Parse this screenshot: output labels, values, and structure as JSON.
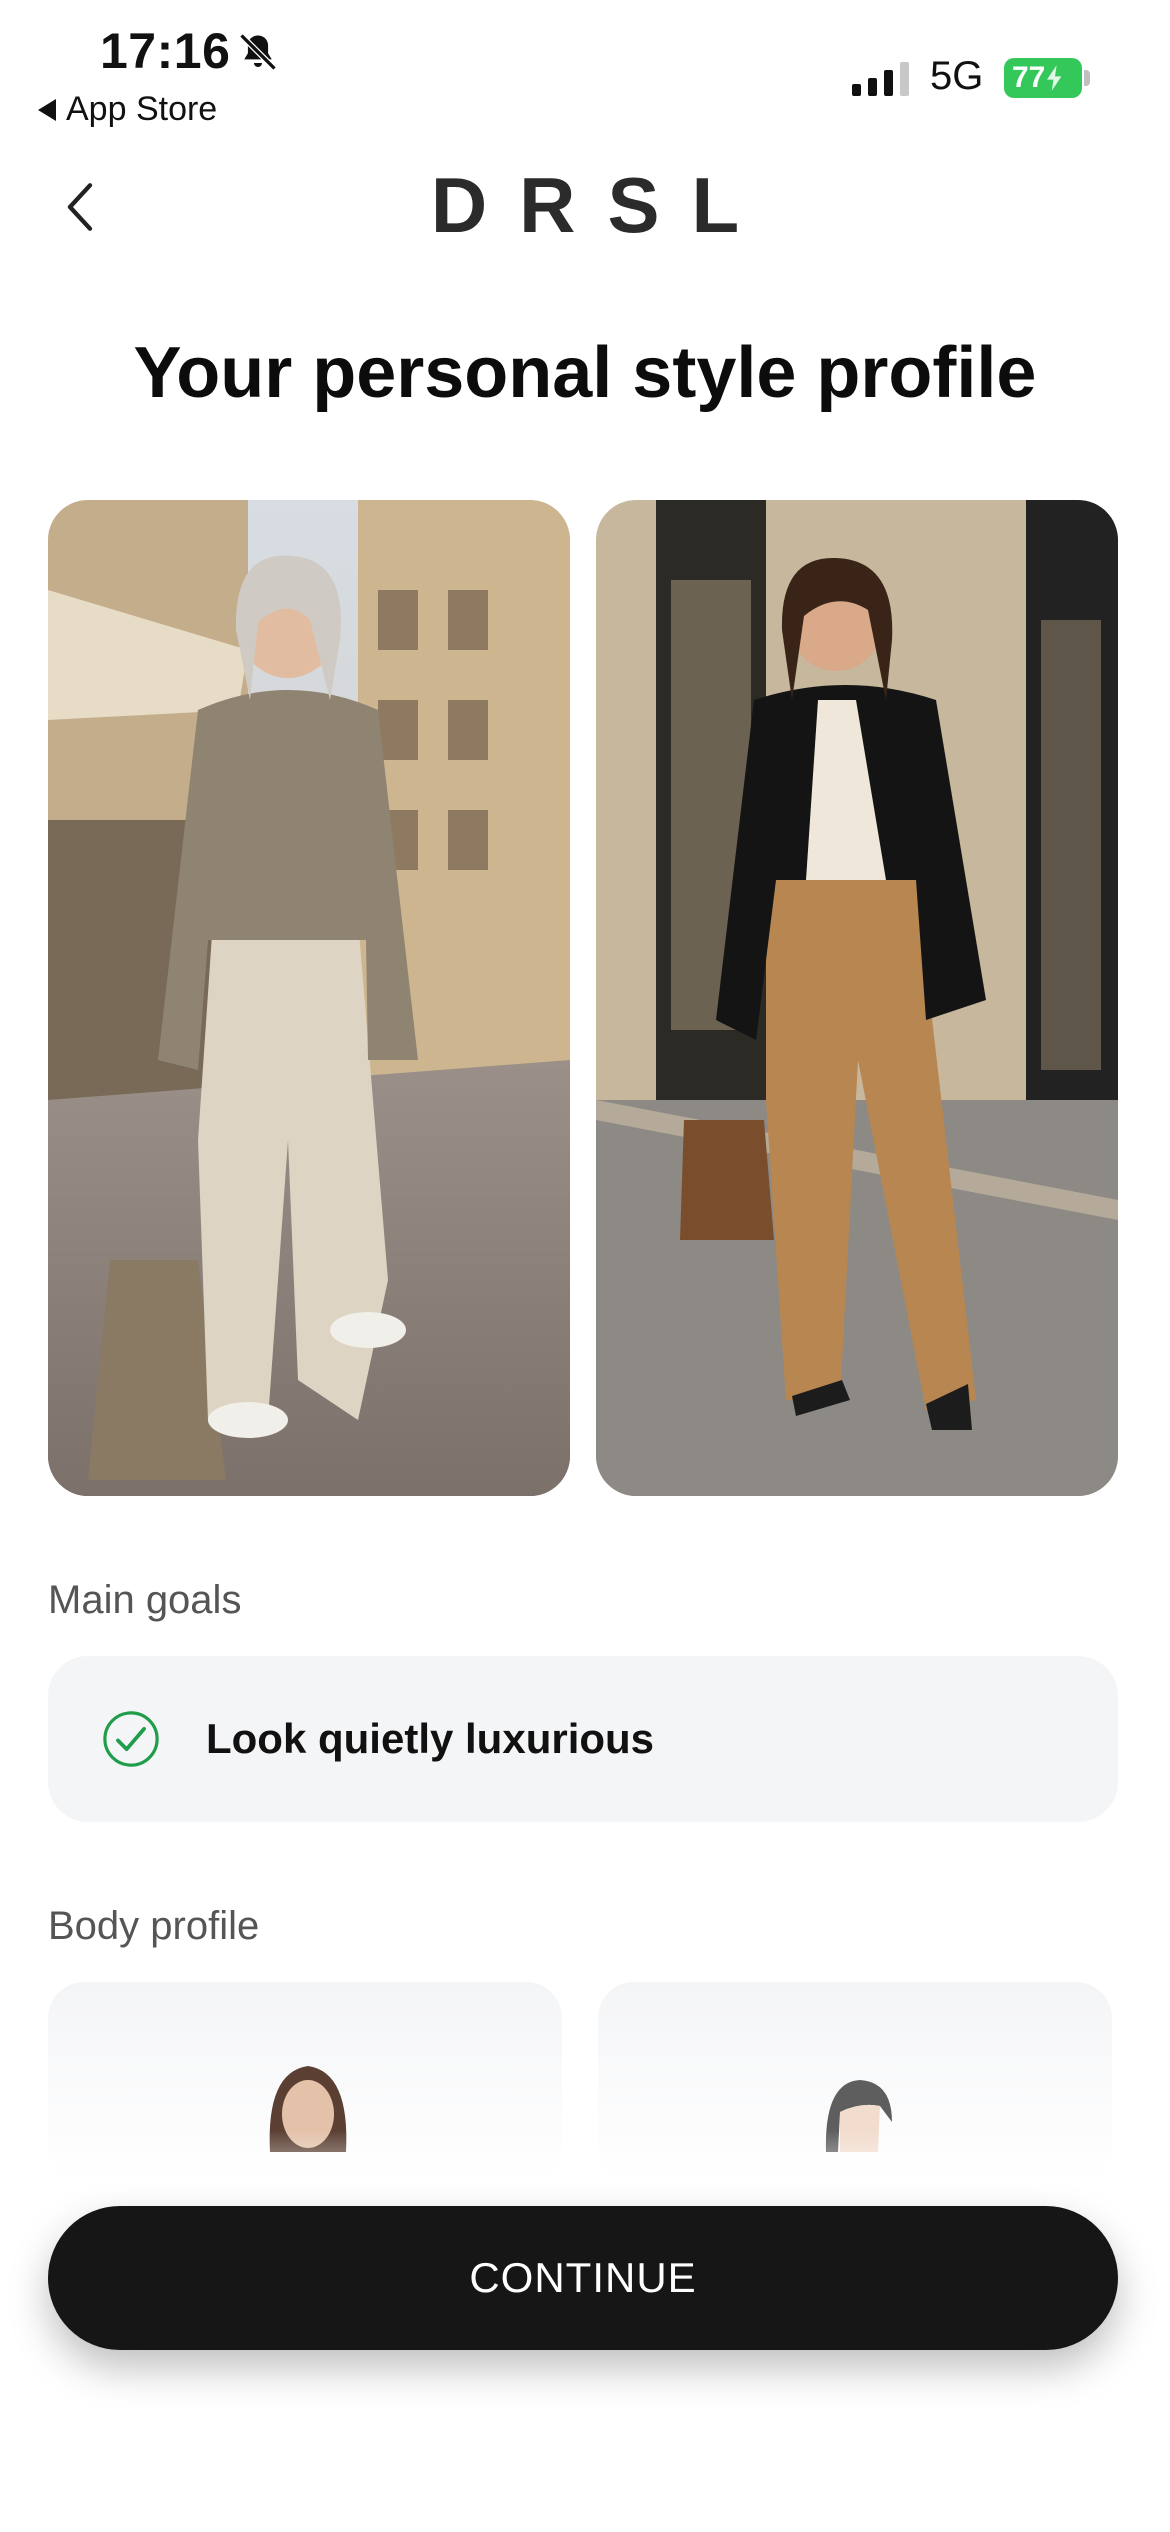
{
  "status_bar": {
    "time": "17:16",
    "back_app": "App Store",
    "network": "5G",
    "battery": "77",
    "battery_color": "#34c759"
  },
  "header": {
    "logo": "DRSL",
    "back_icon": "chevron-left-icon"
  },
  "page_title": "Your personal style profile",
  "style_images": [
    {
      "name": "look-1-photo"
    },
    {
      "name": "look-2-photo"
    }
  ],
  "main_goals": {
    "label": "Main goals",
    "items": [
      {
        "text": "Look quietly luxurious",
        "icon": "check-circle-icon",
        "icon_color": "#1f9d4a"
      }
    ]
  },
  "body_profile": {
    "label": "Body profile"
  },
  "continue_button": {
    "label": "CONTINUE",
    "color": "#161616"
  }
}
